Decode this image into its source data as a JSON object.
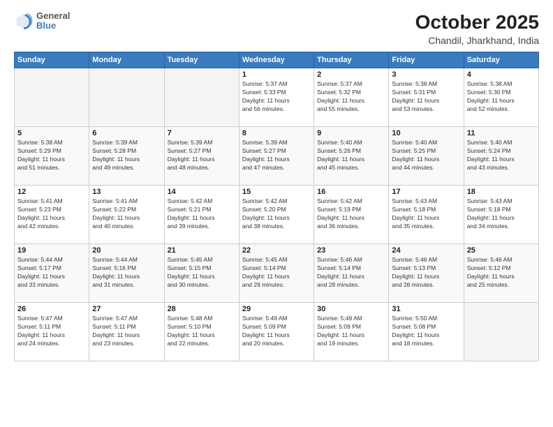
{
  "logo": {
    "general": "General",
    "blue": "Blue"
  },
  "title": {
    "month": "October 2025",
    "location": "Chandil, Jharkhand, India"
  },
  "weekdays": [
    "Sunday",
    "Monday",
    "Tuesday",
    "Wednesday",
    "Thursday",
    "Friday",
    "Saturday"
  ],
  "weeks": [
    [
      {
        "day": "",
        "info": ""
      },
      {
        "day": "",
        "info": ""
      },
      {
        "day": "",
        "info": ""
      },
      {
        "day": "1",
        "info": "Sunrise: 5:37 AM\nSunset: 5:33 PM\nDaylight: 11 hours\nand 56 minutes."
      },
      {
        "day": "2",
        "info": "Sunrise: 5:37 AM\nSunset: 5:32 PM\nDaylight: 11 hours\nand 55 minutes."
      },
      {
        "day": "3",
        "info": "Sunrise: 5:38 AM\nSunset: 5:31 PM\nDaylight: 11 hours\nand 53 minutes."
      },
      {
        "day": "4",
        "info": "Sunrise: 5:38 AM\nSunset: 5:30 PM\nDaylight: 11 hours\nand 52 minutes."
      }
    ],
    [
      {
        "day": "5",
        "info": "Sunrise: 5:38 AM\nSunset: 5:29 PM\nDaylight: 11 hours\nand 51 minutes."
      },
      {
        "day": "6",
        "info": "Sunrise: 5:39 AM\nSunset: 5:28 PM\nDaylight: 11 hours\nand 49 minutes."
      },
      {
        "day": "7",
        "info": "Sunrise: 5:39 AM\nSunset: 5:27 PM\nDaylight: 11 hours\nand 48 minutes."
      },
      {
        "day": "8",
        "info": "Sunrise: 5:39 AM\nSunset: 5:27 PM\nDaylight: 11 hours\nand 47 minutes."
      },
      {
        "day": "9",
        "info": "Sunrise: 5:40 AM\nSunset: 5:26 PM\nDaylight: 11 hours\nand 45 minutes."
      },
      {
        "day": "10",
        "info": "Sunrise: 5:40 AM\nSunset: 5:25 PM\nDaylight: 11 hours\nand 44 minutes."
      },
      {
        "day": "11",
        "info": "Sunrise: 5:40 AM\nSunset: 5:24 PM\nDaylight: 11 hours\nand 43 minutes."
      }
    ],
    [
      {
        "day": "12",
        "info": "Sunrise: 5:41 AM\nSunset: 5:23 PM\nDaylight: 11 hours\nand 42 minutes."
      },
      {
        "day": "13",
        "info": "Sunrise: 5:41 AM\nSunset: 5:22 PM\nDaylight: 11 hours\nand 40 minutes."
      },
      {
        "day": "14",
        "info": "Sunrise: 5:42 AM\nSunset: 5:21 PM\nDaylight: 11 hours\nand 39 minutes."
      },
      {
        "day": "15",
        "info": "Sunrise: 5:42 AM\nSunset: 5:20 PM\nDaylight: 11 hours\nand 38 minutes."
      },
      {
        "day": "16",
        "info": "Sunrise: 5:42 AM\nSunset: 5:19 PM\nDaylight: 11 hours\nand 36 minutes."
      },
      {
        "day": "17",
        "info": "Sunrise: 5:43 AM\nSunset: 5:18 PM\nDaylight: 11 hours\nand 35 minutes."
      },
      {
        "day": "18",
        "info": "Sunrise: 5:43 AM\nSunset: 5:18 PM\nDaylight: 11 hours\nand 34 minutes."
      }
    ],
    [
      {
        "day": "19",
        "info": "Sunrise: 5:44 AM\nSunset: 5:17 PM\nDaylight: 11 hours\nand 33 minutes."
      },
      {
        "day": "20",
        "info": "Sunrise: 5:44 AM\nSunset: 5:16 PM\nDaylight: 11 hours\nand 31 minutes."
      },
      {
        "day": "21",
        "info": "Sunrise: 5:45 AM\nSunset: 5:15 PM\nDaylight: 11 hours\nand 30 minutes."
      },
      {
        "day": "22",
        "info": "Sunrise: 5:45 AM\nSunset: 5:14 PM\nDaylight: 11 hours\nand 29 minutes."
      },
      {
        "day": "23",
        "info": "Sunrise: 5:46 AM\nSunset: 5:14 PM\nDaylight: 11 hours\nand 28 minutes."
      },
      {
        "day": "24",
        "info": "Sunrise: 5:46 AM\nSunset: 5:13 PM\nDaylight: 11 hours\nand 26 minutes."
      },
      {
        "day": "25",
        "info": "Sunrise: 5:46 AM\nSunset: 5:12 PM\nDaylight: 11 hours\nand 25 minutes."
      }
    ],
    [
      {
        "day": "26",
        "info": "Sunrise: 5:47 AM\nSunset: 5:11 PM\nDaylight: 11 hours\nand 24 minutes."
      },
      {
        "day": "27",
        "info": "Sunrise: 5:47 AM\nSunset: 5:11 PM\nDaylight: 11 hours\nand 23 minutes."
      },
      {
        "day": "28",
        "info": "Sunrise: 5:48 AM\nSunset: 5:10 PM\nDaylight: 11 hours\nand 22 minutes."
      },
      {
        "day": "29",
        "info": "Sunrise: 5:49 AM\nSunset: 5:09 PM\nDaylight: 11 hours\nand 20 minutes."
      },
      {
        "day": "30",
        "info": "Sunrise: 5:49 AM\nSunset: 5:09 PM\nDaylight: 11 hours\nand 19 minutes."
      },
      {
        "day": "31",
        "info": "Sunrise: 5:50 AM\nSunset: 5:08 PM\nDaylight: 11 hours\nand 18 minutes."
      },
      {
        "day": "",
        "info": ""
      }
    ]
  ]
}
